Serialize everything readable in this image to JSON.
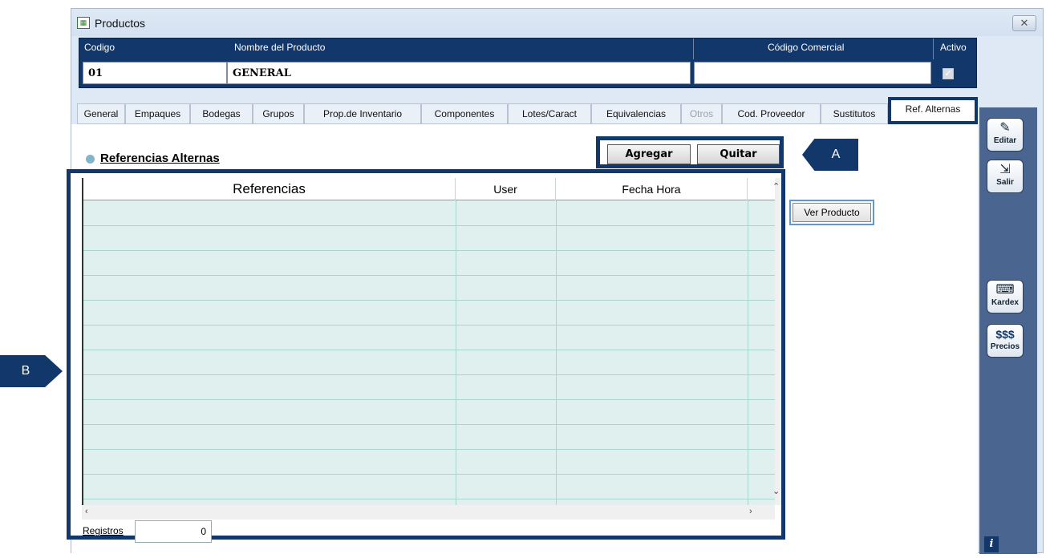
{
  "window": {
    "title": "Productos",
    "close_label": "✕"
  },
  "header": {
    "codigo_label": "Codigo",
    "nombre_label": "Nombre del Producto",
    "comercial_label": "Código Comercial",
    "activo_label": "Activo",
    "codigo_value": "01",
    "nombre_value": "GENERAL",
    "comercial_value": "",
    "activo_checked": true
  },
  "tabs": [
    {
      "label": "General"
    },
    {
      "label": "Empaques"
    },
    {
      "label": "Bodegas"
    },
    {
      "label": "Grupos"
    },
    {
      "label": "Prop.de Inventario"
    },
    {
      "label": "Componentes"
    },
    {
      "label": "Lotes/Caract"
    },
    {
      "label": "Equivalencias"
    },
    {
      "label": "Otros"
    },
    {
      "label": "Cod. Proveedor"
    },
    {
      "label": "Sustitutos"
    },
    {
      "label": "Ref. Alternas"
    }
  ],
  "section": {
    "title": "Referencias Alternas"
  },
  "actions": {
    "agregar_label": "Agregar",
    "quitar_label": "Quitar",
    "ver_producto_label": "Ver Producto"
  },
  "grid": {
    "columns": [
      {
        "label": "Referencias"
      },
      {
        "label": "User"
      },
      {
        "label": "Fecha Hora"
      }
    ],
    "rows": []
  },
  "footer": {
    "registros_label": "Registros",
    "registros_value": "0"
  },
  "sidebar": {
    "editar_label": "Editar",
    "salir_label": "Salir",
    "kardex_label": "Kardex",
    "precios_label": "Precios",
    "precios_symbol": "$$$",
    "info_label": "i"
  },
  "callouts": {
    "a": "A",
    "b": "B"
  },
  "icons": {
    "title": "form-icon",
    "editar": "edit-icon",
    "salir": "exit-door-icon",
    "kardex": "keyboard-icon",
    "info": "info-icon"
  },
  "colors": {
    "accent": "#12386b",
    "grid_background": "#e0f0ef",
    "sidebar": "#4a6590"
  }
}
